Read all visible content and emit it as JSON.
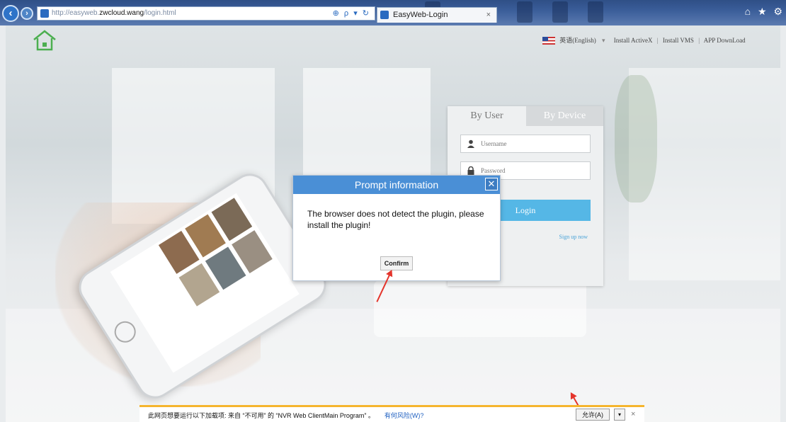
{
  "browser": {
    "url_prefix": "http://easyweb.",
    "url_domain": "zwcloud.wang",
    "url_path": "/login.html",
    "address_tools": "⊕ ρ ▾ ↻",
    "tab_title": "EasyWeb-Login",
    "tab_close": "×",
    "window_icons": "⌂ ★ ⚙"
  },
  "header": {
    "language": "英语(English)",
    "language_arrow": "▾",
    "links": [
      "Install ActiveX",
      "Install VMS",
      "APP DownLoad"
    ],
    "separator": "|"
  },
  "login": {
    "tab_user": "By User",
    "tab_device": "By Device",
    "username_placeholder": "Username",
    "password_placeholder": "Password",
    "login_button": "Login",
    "signup_link": "Sign up now"
  },
  "modal": {
    "title": "Prompt information",
    "close": "✕",
    "message": "The browser does not detect the plugin, please install the plugin!",
    "confirm": "Confirm"
  },
  "notification": {
    "message": "此网页想要运行以下加载项: 来自 “不可用” 的 “NVR Web ClientMain Program” 。",
    "risk_link": "有何风险(W)?",
    "allow_button": "允许(A)",
    "dropdown": "▾",
    "close": "×"
  },
  "colors": {
    "modal_header": "#4a8fd6",
    "login_button": "#55b7e6",
    "annotation_arrow": "#e4352c",
    "notification_border": "#f5b52e"
  }
}
